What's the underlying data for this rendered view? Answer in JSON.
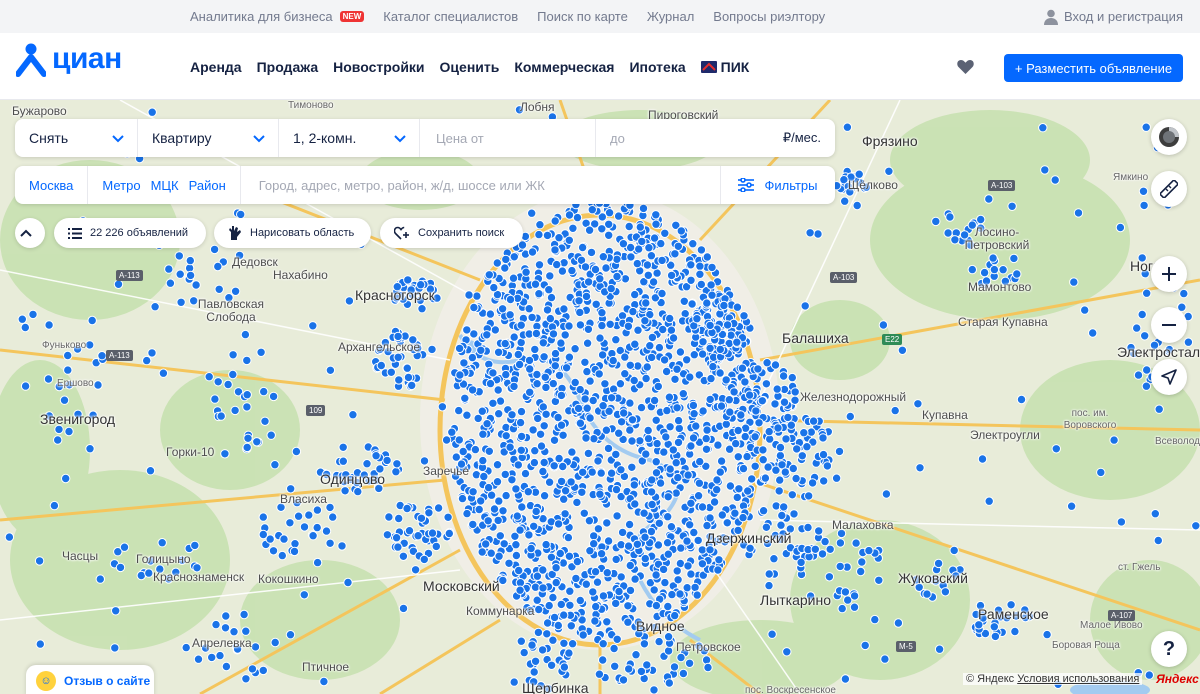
{
  "top_links": [
    {
      "label": "Аналитика для бизнеса",
      "badge": "NEW"
    },
    {
      "label": "Каталог специалистов"
    },
    {
      "label": "Поиск по карте"
    },
    {
      "label": "Журнал"
    },
    {
      "label": "Вопросы риэлтору"
    }
  ],
  "login_label": "Вход и регистрация",
  "logo_text": "циан",
  "main_nav": [
    "Аренда",
    "Продажа",
    "Новостройки",
    "Оценить",
    "Коммерческая",
    "Ипотека",
    "ПИК"
  ],
  "post_button": "+ Разместить объявление",
  "search": {
    "deal_type": "Снять",
    "object_type": "Квартиру",
    "rooms": "1, 2-комн.",
    "price_from_placeholder": "Цена от",
    "price_to_placeholder": "до",
    "price_unit": "₽/мес.",
    "city": "Москва",
    "geo_links": [
      "Метро",
      "МЦК",
      "Район"
    ],
    "geo_placeholder": "Город, адрес, метро, район, ж/д, шоссе или ЖК",
    "filters_label": "Фильтры"
  },
  "chips": {
    "count": "22 226 объявлений",
    "draw": "Нарисовать область",
    "save": "Сохранить поиск"
  },
  "map_labels": {
    "l1": "Бужарово",
    "l2": "Пироговский",
    "l3": "Фрязино",
    "l4": "Ямкино",
    "l5": "Лосино-Петровский",
    "l6": "Ногинск",
    "l7": "Мамонтово",
    "l8": "Старая Купавна",
    "l9": "Электросталь",
    "l10": "Дедовск",
    "l11": "Нахабино",
    "l12": "Павловская Слобода",
    "l13": "Красногорск",
    "l14": "Архангельское",
    "l15": "Фуньково",
    "l16": "Ершово",
    "l17": "Звенигород",
    "l18": "Горки-10",
    "l19": "Одинцово",
    "l20": "Заречье",
    "l21": "Власиха",
    "l22": "Балашиха",
    "l23": "Железнодорожный",
    "l24": "Купавна",
    "l25": "Электроугли",
    "l26": "пос. им. Воровского",
    "l27": "Всеволодово",
    "l28": "Щёлково",
    "l29": "Малаховка",
    "l30": "Дзержинский",
    "l31": "Лыткарино",
    "l32": "Жуковский",
    "l33": "Раменское",
    "l34": "ст. Гжель",
    "l35": "Часцы",
    "l36": "Голицыно",
    "l37": "Краснознаменск",
    "l38": "Кокошкино",
    "l39": "Московский",
    "l40": "Коммунарка",
    "l41": "Видное",
    "l42": "Петровское",
    "l43": "Апрелевка",
    "l44": "Птичное",
    "l45": "Щербинка",
    "l46": "Боровая Роща",
    "l47": "пос. Воскресенское",
    "l48": "Малое Ивово",
    "l49": "Лобня",
    "l50": "Тимоново"
  },
  "road_signs": [
    "A-113",
    "A-103",
    "A-107",
    "M-5",
    "E22",
    "109",
    "A-113",
    "A-103"
  ],
  "review_label": "Отзыв о сайте",
  "copyright": "© Яндекс",
  "terms": "Условия использования",
  "yandex_logo": "Яндекс",
  "colors": {
    "brand": "#0468ff",
    "marker": "#1a73e8",
    "new_badge": "#ef3434"
  },
  "icons": [
    "user-icon",
    "heart-icon",
    "chevron-down-icon",
    "filter-icon",
    "list-icon",
    "draw-hand-icon",
    "save-heart-icon",
    "chevron-up-icon",
    "layers-icon",
    "ruler-icon",
    "zoom-in-icon",
    "zoom-out-icon",
    "locate-icon",
    "help-icon"
  ]
}
